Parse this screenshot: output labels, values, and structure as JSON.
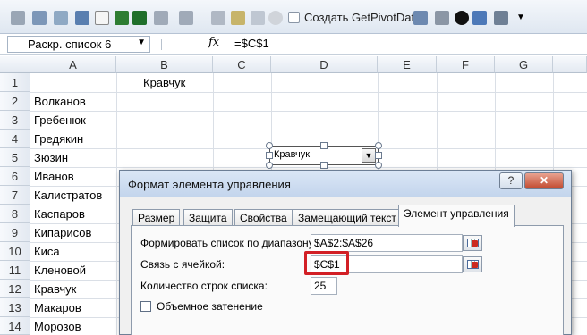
{
  "toolbar": {
    "pivot_checkbox_label": "Создать GetPivotData",
    "icons": [
      "sum-icon",
      "table-icon",
      "chart-icon",
      "save-icon",
      "document-icon",
      "excel-icon",
      "undo-icon",
      "redo-icon",
      "print-icon",
      "lock-icon",
      "clipboard-icon",
      "pivot-icon",
      "camera-icon",
      "filter-icon",
      "dropdown-icon"
    ]
  },
  "formula_bar": {
    "name_box": "Раскр. список 6",
    "fx_label": "fx",
    "formula": "=$C$1"
  },
  "columns": [
    "A",
    "B",
    "C",
    "D",
    "E",
    "F",
    "G"
  ],
  "rows": [
    "1",
    "2",
    "3",
    "4",
    "5",
    "6",
    "7",
    "8",
    "9",
    "10",
    "11",
    "12",
    "13",
    "14"
  ],
  "cells": {
    "B1": "Кравчук",
    "A": [
      "Волканов",
      "Гребенюк",
      "Гредякин",
      "Зюзин",
      "Иванов",
      "Калистратов",
      "Каспаров",
      "Кипарисов",
      "Киса",
      "Кленовой",
      "Кравчук",
      "Макаров",
      "Морозов"
    ]
  },
  "combo_control": {
    "value": "Кравчук",
    "arrow": "▼"
  },
  "dialog": {
    "title": "Формат элемента управления",
    "help_label": "?",
    "close_label": "✕",
    "tabs": [
      "Размер",
      "Защита",
      "Свойства",
      "Замещающий текст",
      "Элемент управления"
    ],
    "active_tab": "Элемент управления",
    "input_range_label": "Формировать список по диапазону:",
    "input_range_value": "$A$2:$A$26",
    "cell_link_label": "Связь с ячейкой:",
    "cell_link_value": "$C$1",
    "dropdown_lines_label": "Количество строк списка:",
    "dropdown_lines_value": "25",
    "shading_label": "Объемное затенение"
  },
  "colors": {
    "highlight": "#d21f25",
    "title_bar": "#c2d4ec",
    "close_button": "#c24a2f"
  }
}
